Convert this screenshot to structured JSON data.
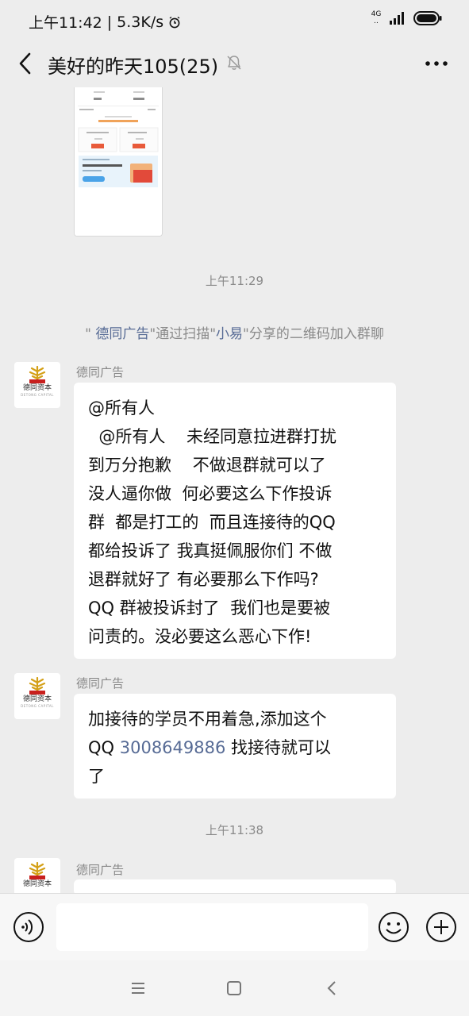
{
  "status_bar": {
    "time": "上午11:42",
    "separator": "|",
    "speed": "5.3K/s",
    "network_badge_top": "4G",
    "network_badge_bottom": "..",
    "icons": [
      "alarm-icon",
      "signal-icon",
      "battery-icon"
    ]
  },
  "header": {
    "title": "美好的昨天105(25)",
    "icons": [
      "back-icon",
      "mute-icon",
      "more-icon"
    ]
  },
  "messages": {
    "time_1": "上午11:29",
    "system": {
      "open_quote": "\"",
      "user": "德同广告",
      "mid": "\"通过扫描\"",
      "inviter": "小易",
      "end": "\"分享的二维码加入群聊"
    },
    "msg1": {
      "sender": "德同广告",
      "lines": [
        "@所有人",
        "  @所有人    未经同意拉进群打扰",
        "到万分抱歉    不做退群就可以了",
        "没人逼你做  何必要这么下作投诉",
        "群  都是打工的  而且连接待的QQ",
        "都给投诉了 我真挺佩服你们 不做",
        "退群就好了 有必要那么下作吗?",
        "QQ 群被投诉封了  我们也是要被",
        "问责的。没必要这么恶心下作!"
      ]
    },
    "msg2": {
      "sender": "德同广告",
      "line1": "加接待的学员不用着急,添加这个",
      "line2_prefix": "QQ ",
      "phone": "3008649886",
      "line2_suffix": " 找接待就可以",
      "line3": "了"
    },
    "time_2": "上午11:38",
    "msg3": {
      "sender": "德同广告"
    }
  },
  "avatar": {
    "name_cn": "德同资本",
    "name_en": "DETONG CAPITAL"
  },
  "input_bar": {
    "icons": [
      "voice-icon",
      "emoji-icon",
      "plus-icon"
    ]
  },
  "nav_bar": {
    "icons": [
      "menu-icon",
      "home-square-icon",
      "back-chevron-icon"
    ]
  },
  "colors": {
    "background": "#ededed",
    "bubble": "#ffffff",
    "link": "#576b95",
    "muted_text": "#8a8a8a"
  }
}
